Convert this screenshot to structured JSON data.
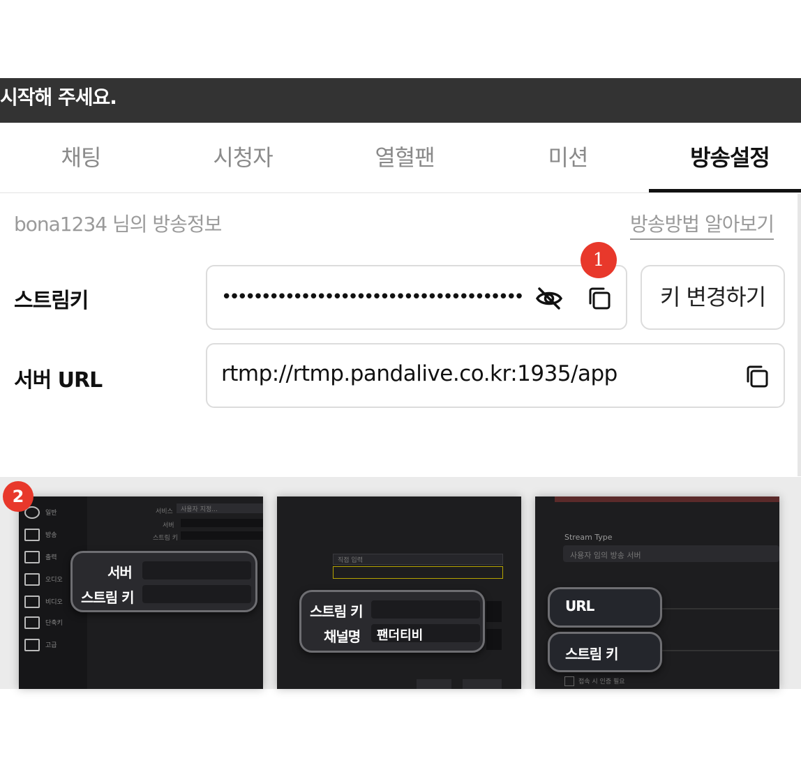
{
  "notice": {
    "text": "시작해 주세요."
  },
  "tabs": [
    {
      "label": "채팅",
      "active": false
    },
    {
      "label": "시청자",
      "active": false
    },
    {
      "label": "열혈팬",
      "active": false
    },
    {
      "label": "미션",
      "active": false
    },
    {
      "label": "방송설정",
      "active": true
    }
  ],
  "broadcast_info": {
    "title": "bona1234 님의 방송정보",
    "how_to_link": "방송방법 알아보기"
  },
  "stream_key": {
    "label": "스트림키",
    "masked_value": "•••••••••••••••••••••••••••••••••••••••••••••••••••",
    "change_button": "키 변경하기",
    "badge": "1"
  },
  "server_url": {
    "label": "서버 URL",
    "value": "rtmp://rtmp.pandalive.co.kr:1935/app"
  },
  "guide": {
    "badge": "2",
    "panel1": {
      "callout_labels": [
        "서버",
        "스트림 키"
      ],
      "sidebar": [
        "일반",
        "방송",
        "출력",
        "오디오",
        "비디오",
        "단축키",
        "고급"
      ],
      "form_labels": [
        "서비스",
        "서버",
        "스트림 키"
      ],
      "service_value": "사용자 지정..."
    },
    "panel2": {
      "callout_labels": [
        "스트림 키",
        "채널명"
      ],
      "channel_value": "팬더티비",
      "select_value": "직접 입력"
    },
    "panel3": {
      "stream_type_label": "Stream Type",
      "stream_type_value": "사용자 임의 방송 서버",
      "callout_labels": [
        "URL",
        "스트림 키"
      ],
      "auth_checkbox": "접속 시 인증 필요"
    }
  },
  "colors": {
    "badge": "#e8382b",
    "notice_bg": "#333333",
    "active_tab": "#111111",
    "inactive_tab": "#8a8a8a"
  }
}
